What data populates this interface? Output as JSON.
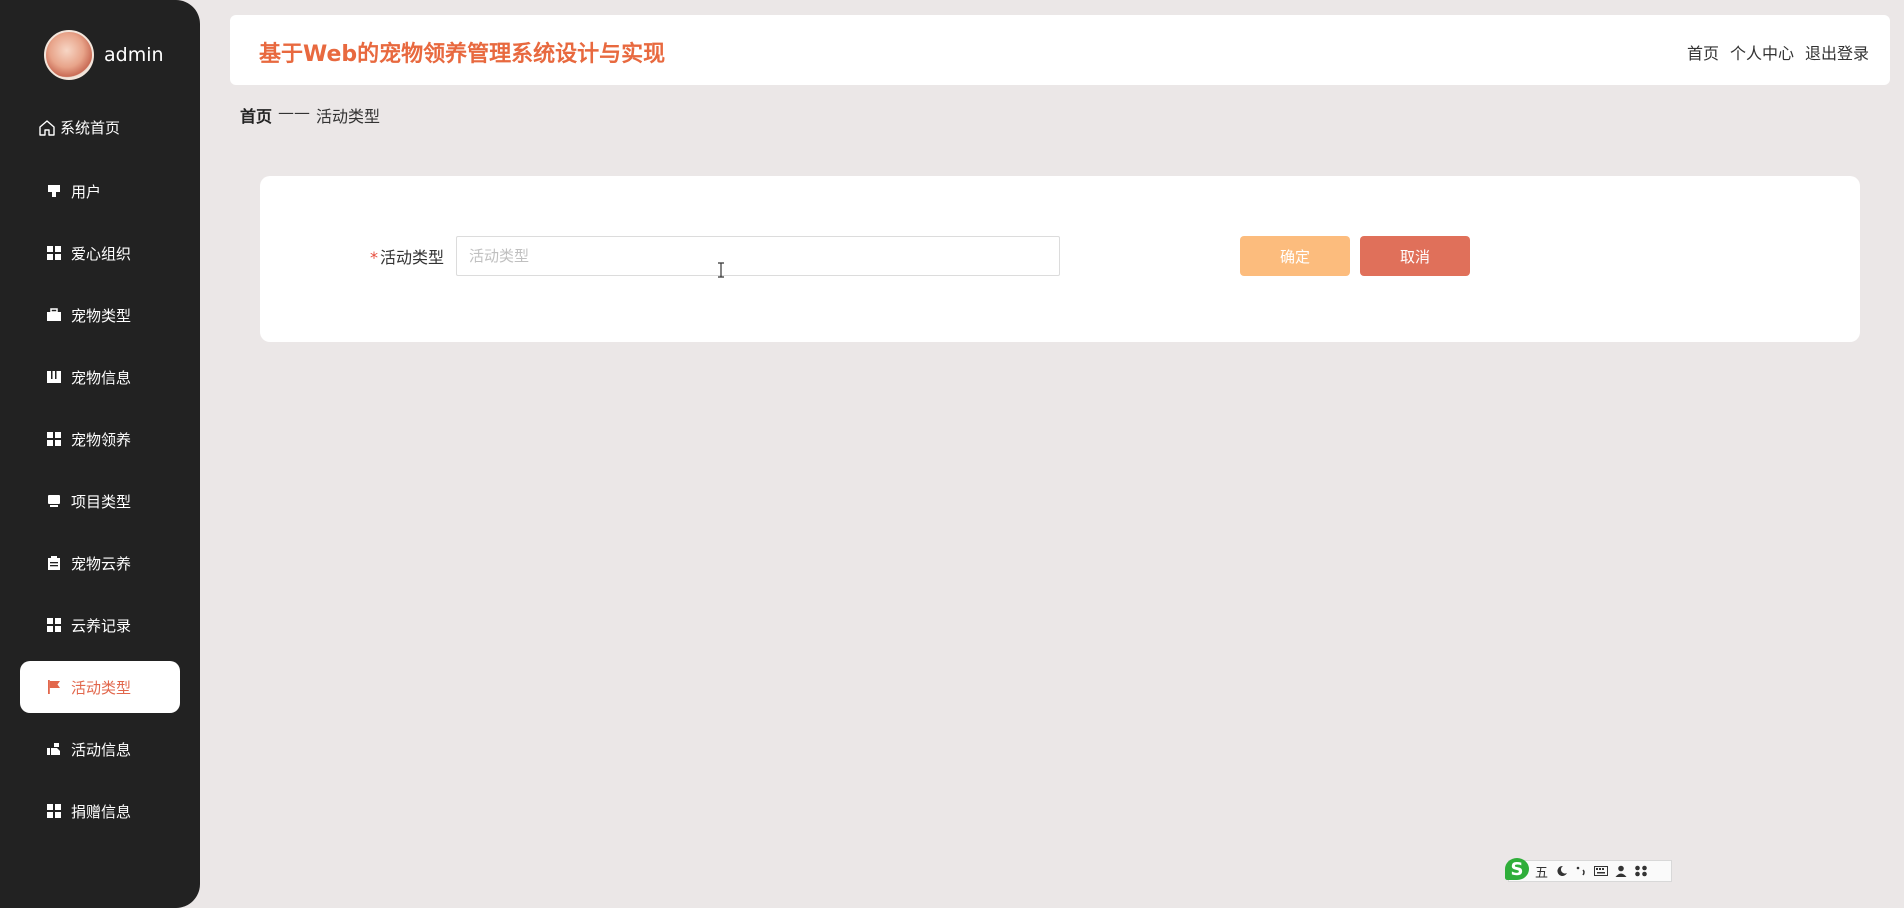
{
  "sidebar": {
    "username": "admin",
    "home_label": "系统首页",
    "items": [
      {
        "label": "用户",
        "icon": "user-icon",
        "active": false
      },
      {
        "label": "爱心组织",
        "icon": "grid-icon",
        "active": false
      },
      {
        "label": "宠物类型",
        "icon": "briefcase-icon",
        "active": false
      },
      {
        "label": "宠物信息",
        "icon": "book-icon",
        "active": false
      },
      {
        "label": "宠物领养",
        "icon": "grid-icon",
        "active": false
      },
      {
        "label": "项目类型",
        "icon": "monitor-icon",
        "active": false
      },
      {
        "label": "宠物云养",
        "icon": "clipboard-icon",
        "active": false
      },
      {
        "label": "云养记录",
        "icon": "grid-icon",
        "active": false
      },
      {
        "label": "活动类型",
        "icon": "flag-icon",
        "active": true
      },
      {
        "label": "活动信息",
        "icon": "hand-icon",
        "active": false
      },
      {
        "label": "捐赠信息",
        "icon": "grid-icon",
        "active": false
      }
    ]
  },
  "header": {
    "title": "基于Web的宠物领养管理系统设计与实现",
    "links": [
      "首页",
      "个人中心",
      "退出登录"
    ]
  },
  "breadcrumb": {
    "home": "首页",
    "separator": "——",
    "current": "活动类型"
  },
  "form": {
    "required_mark": "*",
    "label": "活动类型",
    "value": "",
    "placeholder": "活动类型",
    "confirm_label": "确定",
    "cancel_label": "取消"
  },
  "ime": {
    "mode": "五"
  },
  "colors": {
    "accent": "#e8693f",
    "sidebar_bg": "#222222",
    "confirm": "#fcbc7d",
    "cancel": "#e0705a",
    "page_bg": "#ebe7e7"
  }
}
